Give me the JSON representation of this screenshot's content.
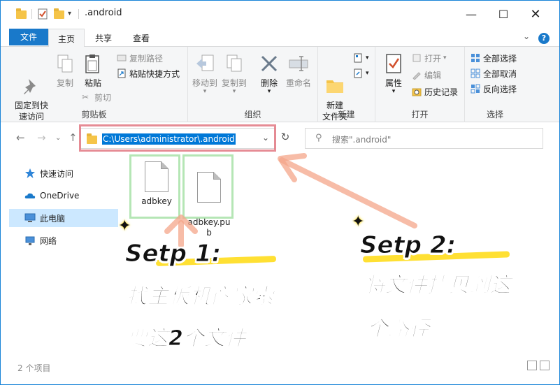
{
  "window": {
    "title": ".android"
  },
  "tabs": {
    "file": "文件",
    "home": "主页",
    "share": "共享",
    "view": "查看"
  },
  "ribbon": {
    "clipboard": {
      "label": "剪贴板",
      "pin_quick_access": "固定到快\n速访问",
      "copy": "复制",
      "paste": "粘贴",
      "copy_path": "复制路径",
      "paste_shortcut": "粘贴快捷方式",
      "cut": "剪切"
    },
    "organize": {
      "label": "组织",
      "move_to": "移动到",
      "copy_to": "复制到",
      "delete": "删除",
      "rename": "重命名"
    },
    "new": {
      "label": "新建",
      "new_folder": "新建\n文件夹"
    },
    "open": {
      "label": "打开",
      "properties": "属性",
      "open": "打开",
      "edit": "编辑",
      "history": "历史记录"
    },
    "select": {
      "label": "选择",
      "select_all": "全部选择",
      "select_none": "全部取消",
      "invert": "反向选择"
    }
  },
  "address": {
    "path": "C:\\Users\\administrator\\.android"
  },
  "search": {
    "placeholder": "搜索\".android\""
  },
  "navpane": {
    "items": [
      {
        "label": "快速访问",
        "icon": "star-icon"
      },
      {
        "label": "OneDrive",
        "icon": "cloud-icon"
      },
      {
        "label": "此电脑",
        "icon": "computer-icon"
      },
      {
        "label": "网络",
        "icon": "network-icon"
      }
    ]
  },
  "files": [
    {
      "name": "adbkey"
    },
    {
      "name": "adbkey.pu\nb"
    }
  ],
  "status": {
    "count": "2 个项目"
  },
  "annotations": {
    "step1_title": "Setp 1:",
    "step1_line1": "找主板机商家索",
    "step1_line2": "要这2个文件",
    "step2_title": "Setp 2:",
    "step2_line1": "将文件拷贝到这",
    "step2_line2": "个路径"
  },
  "colors": {
    "accent": "#1979ca",
    "selection": "#0078d7",
    "highlight": "#ffe033",
    "red_frame": "#e27882",
    "green_frame": "#96dc96",
    "arrow": "#f4a58a"
  }
}
